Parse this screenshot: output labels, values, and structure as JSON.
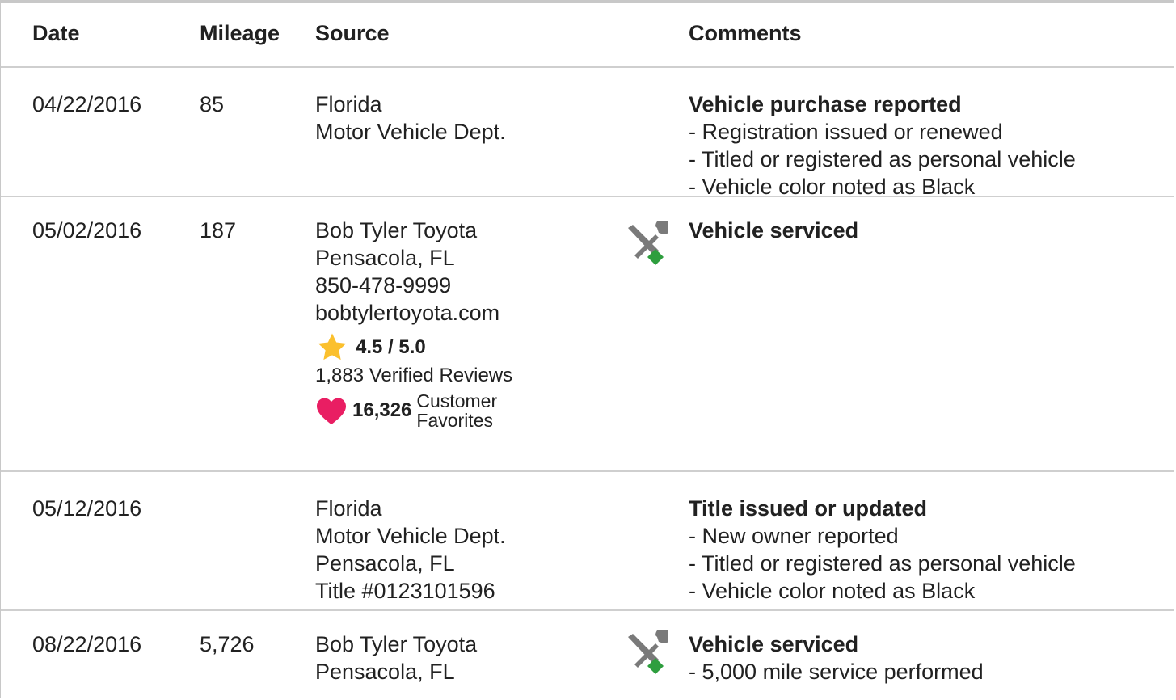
{
  "headers": {
    "date": "Date",
    "mileage": "Mileage",
    "source": "Source",
    "comments": "Comments"
  },
  "rows": [
    {
      "date": "04/22/2016",
      "mileage": "85",
      "source": [
        "Florida",
        "Motor Vehicle Dept."
      ],
      "comment_title": "Vehicle purchase reported",
      "comment_items": [
        "Registration issued or renewed",
        "Titled or registered as personal vehicle",
        "Vehicle color noted as Black"
      ]
    },
    {
      "date": "05/02/2016",
      "mileage": "187",
      "source": [
        "Bob Tyler Toyota",
        "Pensacola, FL",
        "850-478-9999",
        "bobtylertoyota.com"
      ],
      "rating": "4.5 / 5.0",
      "reviews": "1,883 Verified Reviews",
      "favorites_count": "16,326",
      "favorites_label": [
        "Customer",
        "Favorites"
      ],
      "icon": "service-wrench-icon",
      "comment_title": "Vehicle serviced",
      "comment_items": []
    },
    {
      "date": "05/12/2016",
      "mileage": "",
      "source": [
        "Florida",
        "Motor Vehicle Dept.",
        "Pensacola, FL",
        "Title #0123101596"
      ],
      "comment_title": "Title issued or updated",
      "comment_items": [
        "New owner reported",
        "Titled or registered as personal vehicle",
        "Vehicle color noted as Black"
      ]
    },
    {
      "date": "08/22/2016",
      "mileage": "5,726",
      "source": [
        "Bob Tyler Toyota",
        "Pensacola, FL"
      ],
      "icon": "service-wrench-icon",
      "comment_title": "Vehicle serviced",
      "comment_items": [
        "5,000 mile service performed"
      ]
    }
  ],
  "colors": {
    "star": "#FBC02D",
    "heart": "#E91E63",
    "wrench_handle": "#2E9E3E",
    "wrench_metal": "#7A7A7A"
  }
}
